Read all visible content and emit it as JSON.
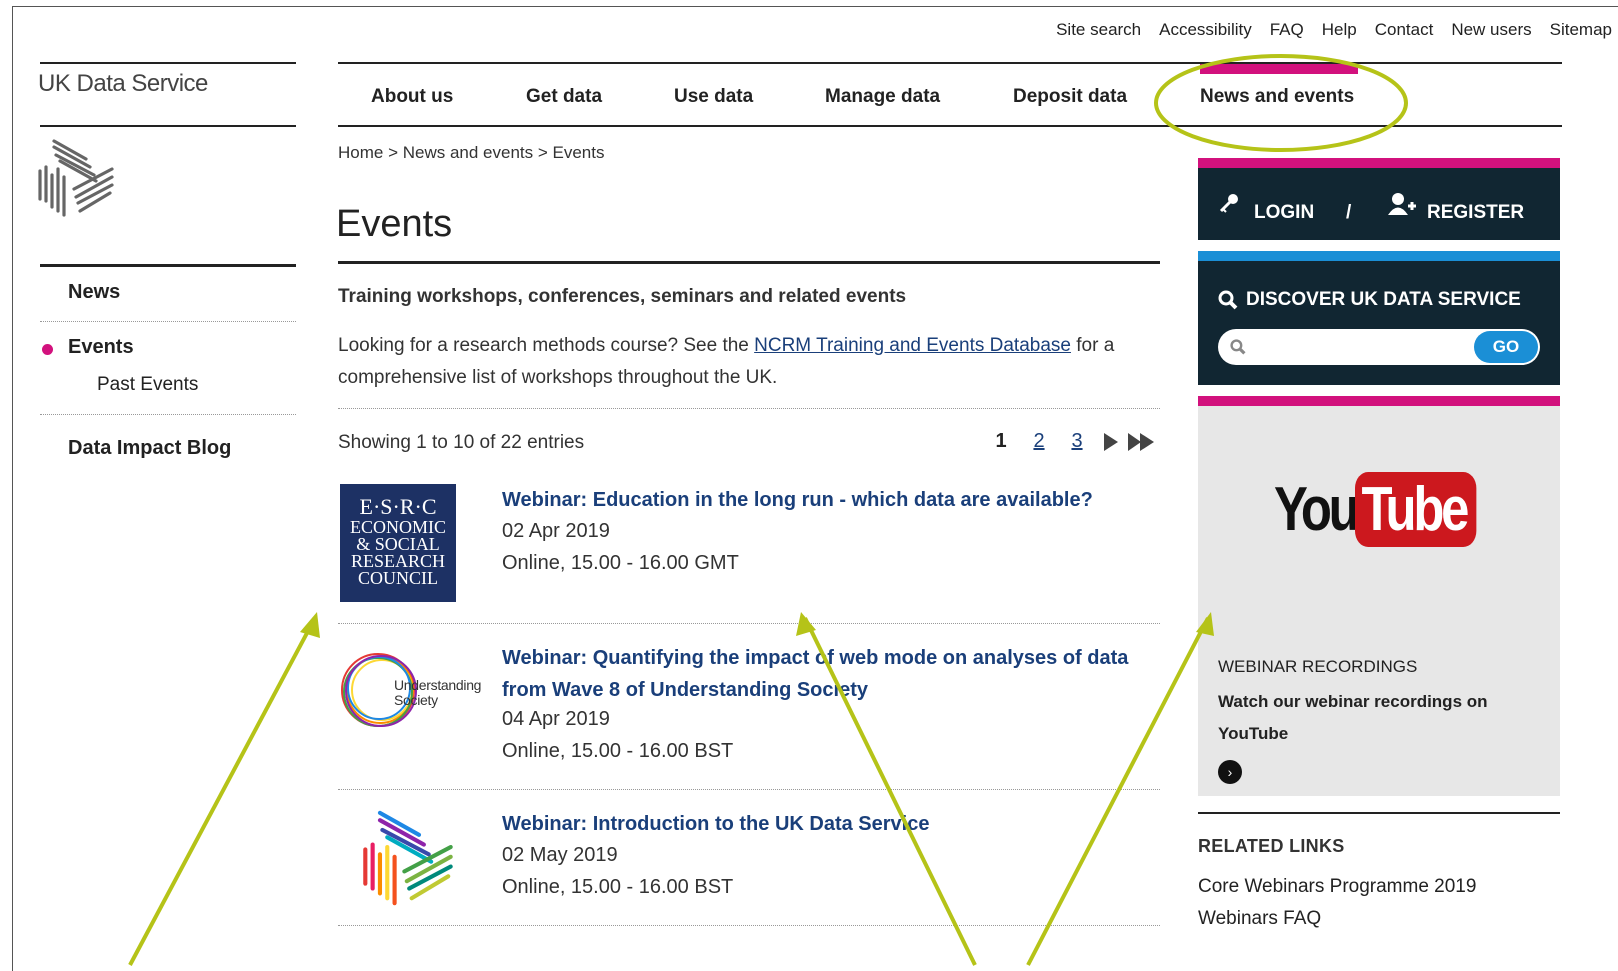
{
  "utility_links": [
    "Site search",
    "Accessibility",
    "FAQ",
    "Help",
    "Contact",
    "New users",
    "Sitemap"
  ],
  "brand": "UK Data Service",
  "main_nav": [
    "About us",
    "Get data",
    "Use data",
    "Manage data",
    "Deposit data",
    "News and events"
  ],
  "breadcrumb": "Home > News and events > Events",
  "left_nav": {
    "news": "News",
    "events": "Events",
    "past_events": "Past Events",
    "blog": "Data Impact Blog"
  },
  "page": {
    "title": "Events",
    "subhead": "Training workshops, conferences, seminars and related events",
    "intro_pre": "Looking for a research methods course? See the ",
    "intro_link": "NCRM Training and Events Database",
    "intro_post": " for a comprehensive list of workshops throughout the UK.",
    "showing": "Showing 1 to 10 of 22 entries"
  },
  "pager": {
    "current": "1",
    "p2": "2",
    "p3": "3"
  },
  "events": [
    {
      "title": "Webinar: Education in the long run - which data are available?",
      "date": "02 Apr 2019",
      "location": "Online, 15.00 - 16.00 GMT",
      "logo_text": [
        "E·S·R·C",
        "ECONOMIC",
        "& SOCIAL",
        "RESEARCH",
        "COUNCIL"
      ]
    },
    {
      "title": "Webinar: Quantifying the impact of web mode on analyses of data from Wave 8 of Understanding Society",
      "date": "04 Apr 2019",
      "location": "Online, 15.00 - 16.00 BST",
      "logo_text": [
        "Understanding",
        "Society"
      ]
    },
    {
      "title": "Webinar: Introduction to the UK Data Service",
      "date": "02 May 2019",
      "location": "Online, 15.00 - 16.00 BST"
    }
  ],
  "sidebar": {
    "login": "LOGIN",
    "separator": "/",
    "register": "REGISTER",
    "discover": "DISCOVER UK DATA SERVICE",
    "search_value": "",
    "go": "GO",
    "youtube_you": "You",
    "youtube_tube": "Tube",
    "webinar_heading": "WEBINAR RECORDINGS",
    "webinar_text": "Watch our webinar recordings on YouTube",
    "related_heading": "RELATED LINKS",
    "related_links": [
      "Core Webinars Programme 2019",
      "Webinars FAQ"
    ]
  },
  "colors": {
    "pink": "#d2117d",
    "navy": "#112632",
    "blue": "#1b8fd6",
    "link": "#1a3f7a",
    "annotation": "#b5c318"
  }
}
